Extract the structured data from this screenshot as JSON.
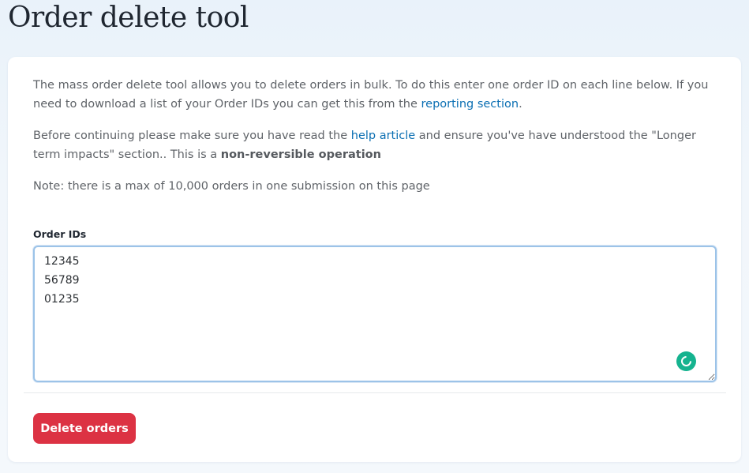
{
  "page": {
    "title": "Order delete tool"
  },
  "intro": {
    "p1_text": "The mass order delete tool allows you to delete orders in bulk. To do this enter one order ID on each line below. If you need to download a list of your Order IDs you can get this from the ",
    "p1_link": "reporting section",
    "p1_end": ".",
    "p2_text": "Before continuing please make sure you have read the ",
    "p2_link": "help article",
    "p2_mid": " and ensure you've have understood the \"Longer term impacts\" section.. This is a ",
    "p2_strong": "non-reversible operation",
    "p3_text": "Note: there is a max of 10,000 orders in one submission on this page"
  },
  "form": {
    "order_ids_label": "Order IDs",
    "order_ids_value": "12345\n56789\n01235"
  },
  "actions": {
    "delete_label": "Delete orders"
  },
  "colors": {
    "accent_link": "#0b6fb3",
    "danger_button": "#dc3243",
    "assistant_icon": "#15b38f",
    "focus_border": "#9cc3e8"
  },
  "icons": {
    "assistant": "grammar-assistant-icon",
    "resize": "resize-handle-icon"
  }
}
